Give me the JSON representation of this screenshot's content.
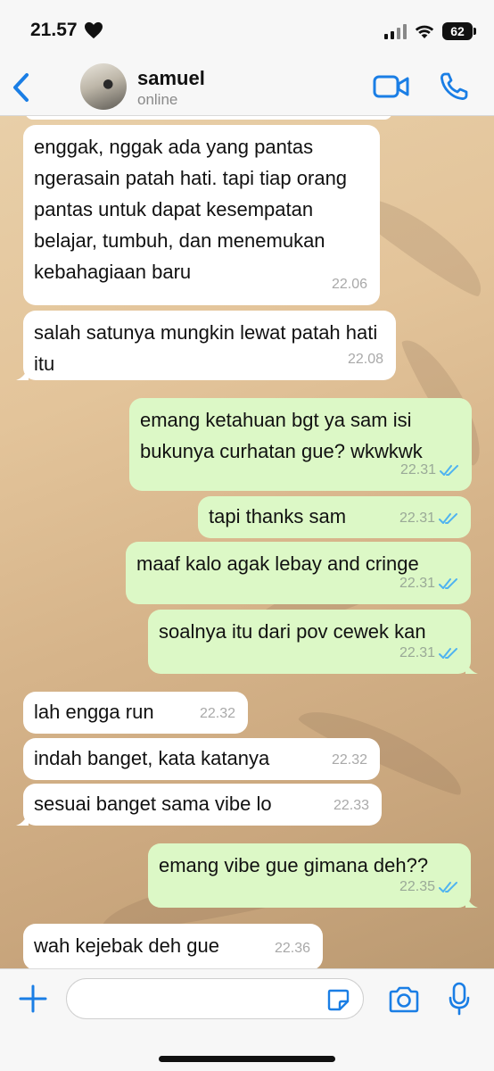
{
  "status_bar": {
    "time": "21.57",
    "battery": "62"
  },
  "header": {
    "contact_name": "samuel",
    "contact_status": "online"
  },
  "colors": {
    "accent": "#1a7ee5",
    "incoming_bubble": "#ffffff",
    "outgoing_bubble": "#dcf8c6",
    "read_tick": "#4fb3f0"
  },
  "messages": [
    {
      "dir": "in",
      "text": "enggak, nggak ada yang pantas ngerasain patah hati. tapi tiap orang pantas untuk dapat kesempatan belajar, tumbuh, dan menemukan kebahagiaan baru",
      "time": "22.06"
    },
    {
      "dir": "in",
      "text": "salah satunya mungkin lewat patah hati itu",
      "time": "22.08"
    },
    {
      "dir": "out",
      "text": "emang ketahuan bgt ya sam isi bukunya curhatan gue? wkwkwk",
      "time": "22.31",
      "status": "read"
    },
    {
      "dir": "out",
      "text": "tapi thanks sam",
      "time": "22.31",
      "status": "read"
    },
    {
      "dir": "out",
      "text": "maaf kalo agak lebay and cringe",
      "time": "22.31",
      "status": "read"
    },
    {
      "dir": "out",
      "text": "soalnya itu dari pov cewek kan",
      "time": "22.31",
      "status": "read"
    },
    {
      "dir": "in",
      "text": "lah engga run",
      "time": "22.32"
    },
    {
      "dir": "in",
      "text": "indah banget, kata katanya",
      "time": "22.32"
    },
    {
      "dir": "in",
      "text": "sesuai banget sama vibe lo",
      "time": "22.33"
    },
    {
      "dir": "out",
      "text": "emang vibe gue gimana deh??",
      "time": "22.35",
      "status": "read"
    },
    {
      "dir": "in",
      "text": "wah kejebak deh gue",
      "time": "22.36"
    }
  ],
  "composer": {
    "placeholder": "",
    "value": ""
  },
  "icons": [
    "back-chevron-icon",
    "video-call-icon",
    "phone-icon",
    "plus-icon",
    "sticker-icon",
    "camera-icon",
    "microphone-icon",
    "heart-icon",
    "signal-icon",
    "wifi-icon",
    "battery-icon",
    "double-check-icon"
  ]
}
